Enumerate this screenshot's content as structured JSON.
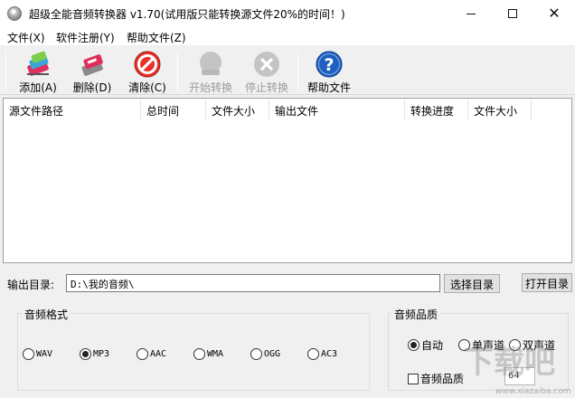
{
  "window": {
    "title": "超级全能音频转换器 v1.70(试用版只能转换源文件20%的时间！)",
    "app_icon": "cd-disc-icon"
  },
  "menu": [
    "文件(X)",
    "软件注册(Y)",
    "帮助文件(Z)"
  ],
  "toolbar": [
    {
      "label": "添加(A)",
      "icon": "add-files-icon",
      "enabled": true
    },
    {
      "label": "删除(D)",
      "icon": "delete-files-icon",
      "enabled": true
    },
    {
      "label": "清除(C)",
      "icon": "clear-icon",
      "enabled": true
    },
    {
      "label": "开始转换",
      "icon": "start-convert-icon",
      "enabled": false
    },
    {
      "label": "停止转换",
      "icon": "stop-convert-icon",
      "enabled": false
    },
    {
      "label": "帮助文件",
      "icon": "help-icon",
      "enabled": true
    }
  ],
  "file_list": {
    "columns": [
      "源文件路径",
      "总时间",
      "文件大小",
      "输出文件",
      "转换进度",
      "文件大小"
    ],
    "rows": []
  },
  "output": {
    "label": "输出目录:",
    "path": "D:\\我的音频\\",
    "choose_button": "选择目录",
    "open_button": "打开目录"
  },
  "format_group": {
    "title": "音频格式",
    "options": [
      "WAV",
      "MP3",
      "AAC",
      "WMA",
      "OGG",
      "AC3"
    ],
    "selected": "MP3"
  },
  "quality_group": {
    "title": "音频品质",
    "options": [
      "自动",
      "单声道",
      "双声道"
    ],
    "selected": "自动",
    "quality_checkbox": "音频品质",
    "quality_checked": false,
    "bitrate_value": "64"
  },
  "watermark": {
    "text": "下载吧",
    "site": "www.xiazaiba.com"
  },
  "colors": {
    "close_red": "#e81123",
    "help_blue": "#1f5fbf",
    "disabled_gray": "#9a9a9a"
  }
}
